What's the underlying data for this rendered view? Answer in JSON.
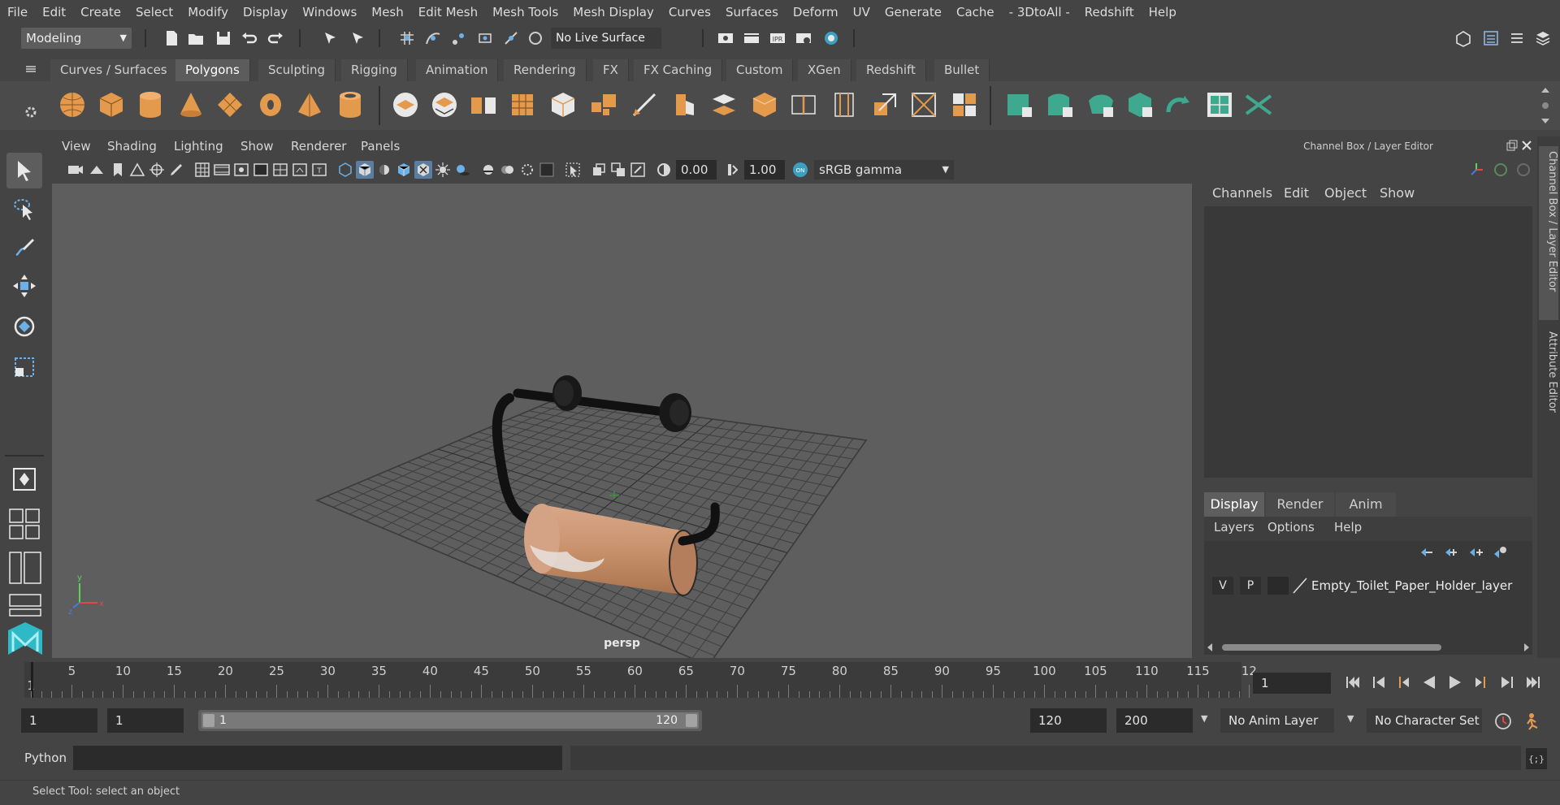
{
  "menubar": {
    "items": [
      "File",
      "Edit",
      "Create",
      "Select",
      "Modify",
      "Display",
      "Windows",
      "Mesh",
      "Edit Mesh",
      "Mesh Tools",
      "Mesh Display",
      "Curves",
      "Surfaces",
      "Deform",
      "UV",
      "Generate",
      "Cache",
      "- 3DtoAll -",
      "Redshift",
      "Help"
    ]
  },
  "statusline": {
    "menuset": "Modeling",
    "live_surface": "No Live Surface"
  },
  "shelf": {
    "tabs": [
      "Curves / Surfaces",
      "Polygons",
      "Sculpting",
      "Rigging",
      "Animation",
      "Rendering",
      "FX",
      "FX Caching",
      "Custom",
      "XGen",
      "Redshift",
      "Bullet"
    ],
    "active_tab": "Polygons"
  },
  "viewport": {
    "menu": [
      "View",
      "Shading",
      "Lighting",
      "Show",
      "Renderer",
      "Panels"
    ],
    "exposure": "0.00",
    "gamma": "1.00",
    "color_space": "sRGB gamma",
    "camera_label": "persp"
  },
  "right_panel": {
    "title": "Channel Box / Layer Editor",
    "menu": [
      "Channels",
      "Edit",
      "Object",
      "Show"
    ],
    "layer_tabs": [
      "Display",
      "Render",
      "Anim"
    ],
    "layer_menu": [
      "Layers",
      "Options",
      "Help"
    ],
    "layer": {
      "v": "V",
      "p": "P",
      "name": "Empty_Toilet_Paper_Holder_layer"
    },
    "side_tabs": [
      "Channel Box / Layer Editor",
      "Attribute Editor"
    ]
  },
  "timeline": {
    "start_label": "1",
    "ticks": [
      "5",
      "10",
      "15",
      "20",
      "25",
      "30",
      "35",
      "40",
      "45",
      "50",
      "55",
      "60",
      "65",
      "70",
      "75",
      "80",
      "85",
      "90",
      "95",
      "100",
      "105",
      "110",
      "115",
      "12"
    ],
    "current_frame": "1"
  },
  "range": {
    "start": "1",
    "playback_start": "1",
    "slider_start": "1",
    "slider_end": "120",
    "playback_end": "120",
    "end": "200",
    "anim_layer": "No Anim Layer",
    "character_set": "No Character Set"
  },
  "command": {
    "language": "Python"
  },
  "help_line": {
    "text": "Select Tool: select an object"
  },
  "colors": {
    "shelf_orange": "#e39a4c",
    "shelf_teal": "#3fa98f",
    "active_blue": "#5b7da0",
    "paper": "#c8926c"
  }
}
